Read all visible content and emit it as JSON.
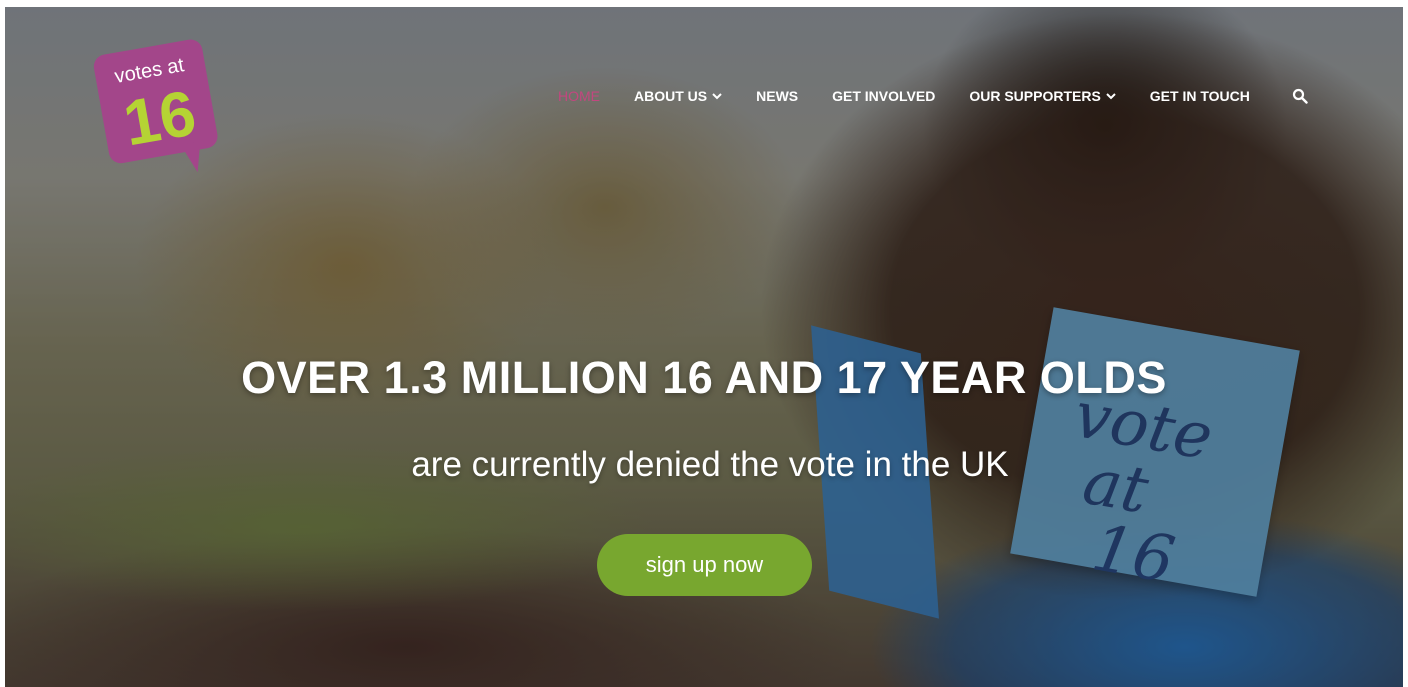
{
  "logo": {
    "line1": "votes at",
    "line2": "16",
    "colors": {
      "bubble": "#a3468a",
      "text1": "#ffffff",
      "text2": "#b5d334"
    }
  },
  "nav": {
    "items": [
      {
        "label": "HOME",
        "active": true,
        "dropdown": false
      },
      {
        "label": "ABOUT US",
        "active": false,
        "dropdown": true
      },
      {
        "label": "NEWS",
        "active": false,
        "dropdown": false
      },
      {
        "label": "GET INVOLVED",
        "active": false,
        "dropdown": false
      },
      {
        "label": "OUR SUPPORTERS",
        "active": false,
        "dropdown": true
      },
      {
        "label": "GET IN TOUCH",
        "active": false,
        "dropdown": false
      }
    ],
    "search_icon": "search-icon",
    "active_color": "#c2477f"
  },
  "hero": {
    "headline": "OVER 1.3 MILLION 16 AND 17 YEAR OLDS",
    "subheadline": "are currently denied the vote in the UK",
    "cta_label": "sign up now",
    "cta_color": "#78a72f"
  }
}
